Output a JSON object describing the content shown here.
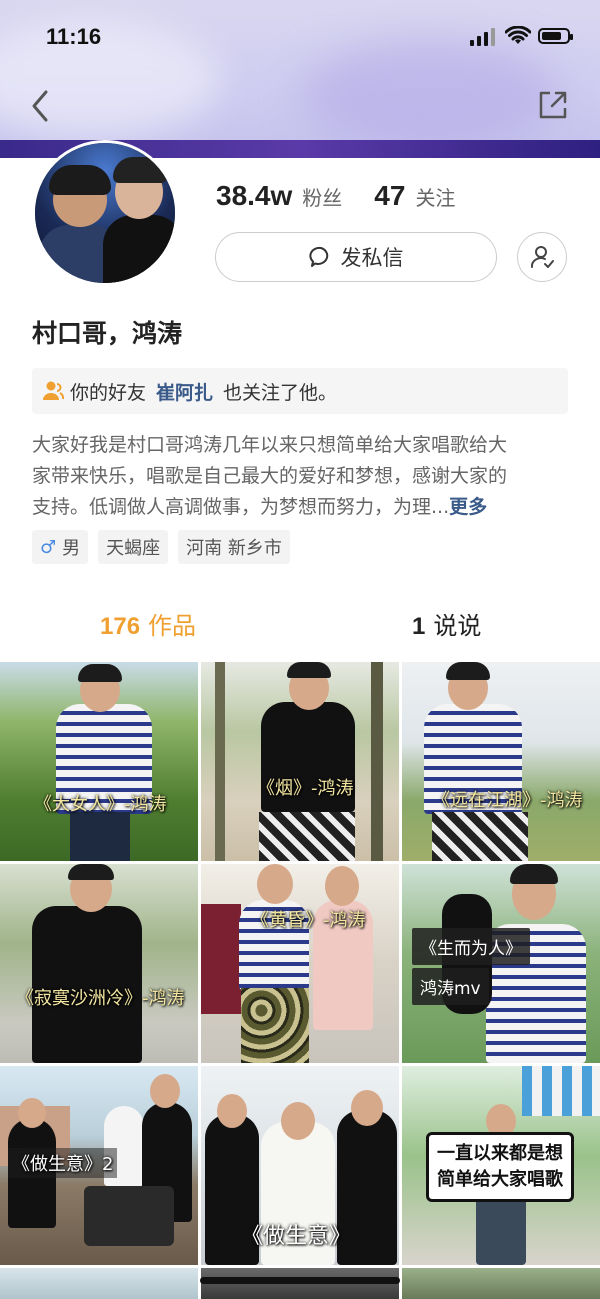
{
  "status_bar": {
    "time": "11:16",
    "battery_level_percent": 80
  },
  "header": {
    "back_icon": "chevron-left-icon",
    "share_icon": "share-icon"
  },
  "profile": {
    "followers_count": "38.4w",
    "followers_label": "粉丝",
    "following_count": "47",
    "following_label": "关注",
    "message_button_label": "发私信",
    "name": "村口哥，鸿涛",
    "friend_prefix": "你的好友",
    "friend_name": "崔阿扎",
    "friend_suffix": "也关注了他。",
    "bio_line1": "大家好我是村口哥鸿涛几年以来只想简单给大家唱歌给大",
    "bio_line2": "家带来快乐，唱歌是自己最大的爱好和梦想，感谢大家的",
    "bio_line3": "支持。低调做人高调做事，为梦想而努力，为理...",
    "bio_more": "更多",
    "tag_gender_icon": "♂",
    "tag_gender": "男",
    "tag_zodiac": "天蝎座",
    "tag_location": "河南 新乡市"
  },
  "tabs": {
    "works_count": "176",
    "works_label": "作品",
    "posts_count": "1",
    "posts_label": "说说"
  },
  "grid": {
    "tiles": [
      {
        "caption": "《大女人》-鸿涛"
      },
      {
        "caption": "《烟》-鸿涛"
      },
      {
        "caption": "《远在江湖》-鸿涛"
      },
      {
        "caption": "《寂寞沙洲冷》-鸿涛"
      },
      {
        "caption": "《黄昏》-鸿涛"
      },
      {
        "caption_line1": "《生而为人》",
        "caption_line2": "鸿涛mv"
      },
      {
        "caption": "《做生意》2"
      },
      {
        "caption": "《做生意》"
      },
      {
        "caption_line1": "一直以来都是想",
        "caption_line2": "简单给大家唱歌"
      }
    ]
  },
  "colors": {
    "accent": "#f0a030",
    "link": "#3a5a8a"
  }
}
